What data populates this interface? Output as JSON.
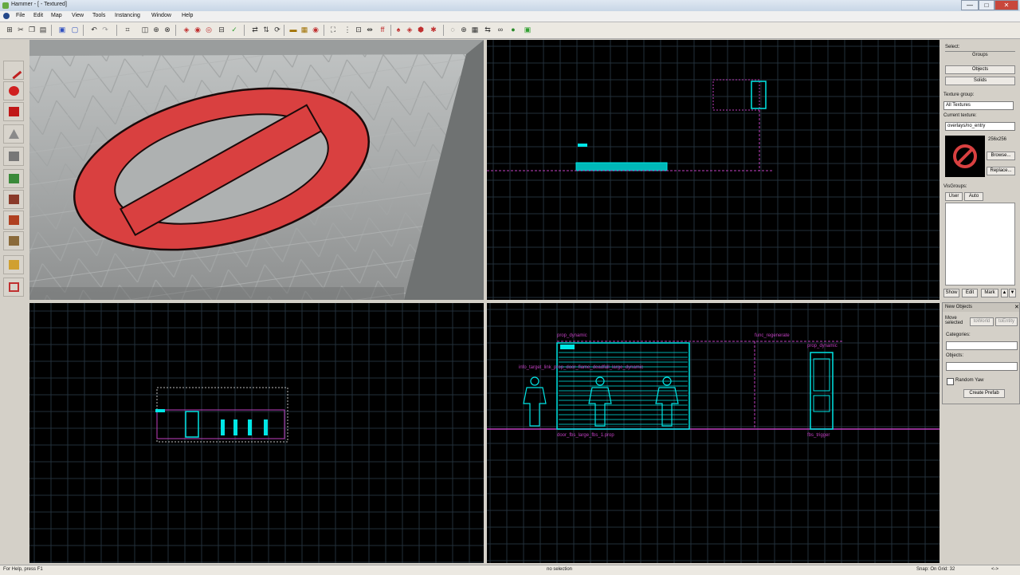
{
  "window": {
    "title": "Hammer - [ - Textured]",
    "minimize": "—",
    "maximize": "□",
    "close": "✕"
  },
  "menu": [
    "File",
    "Edit",
    "Map",
    "View",
    "Tools",
    "Instancing",
    "Window",
    "Help"
  ],
  "viewports": {
    "top_right": {
      "labels": []
    },
    "bottom_right": {
      "labels": [
        "prop_dynamic",
        "info_target_link_prop_door_flame_deadfall_large_dynamic",
        "func_regenerate",
        "prop_dynamic",
        "door_fbs_large_fbs_1.prop",
        "fbs_trigger"
      ]
    }
  },
  "rightpanel": {
    "select_label": "Select:",
    "groups_label": "Groups",
    "objects_btn": "Objects",
    "solids_btn": "Solids",
    "texture_group_label": "Texture group:",
    "texture_group_value": "All Textures",
    "current_texture_label": "Current texture:",
    "current_texture_value": "overlays/no_entry",
    "texture_size": "256x256",
    "browse_btn": "Browse...",
    "replace_btn": "Replace...",
    "visgroups_label": "VisGroups:",
    "tab_user": "User",
    "tab_auto": "Auto",
    "show_btn": "Show",
    "edit_btn": "Edit",
    "mark_btn": "Mark"
  },
  "newobjects": {
    "title": "New Objects",
    "move_selected": "Move selected",
    "to_world": "toWorld",
    "to_entity": "toEntity",
    "categories_label": "Categories:",
    "objects_label": "Objects:",
    "random_yaw": "Random Yaw",
    "create_prefab": "Create Prefab"
  },
  "status": {
    "help": "For Help, press F1",
    "selection": "no selection",
    "snap": "Snap: On Grid: 32",
    "coords": "<->"
  },
  "colors": {
    "entity": "#00e6e6",
    "label": "#c040c0",
    "grid": "#1c2a2a",
    "sign_red": "#d94040"
  }
}
